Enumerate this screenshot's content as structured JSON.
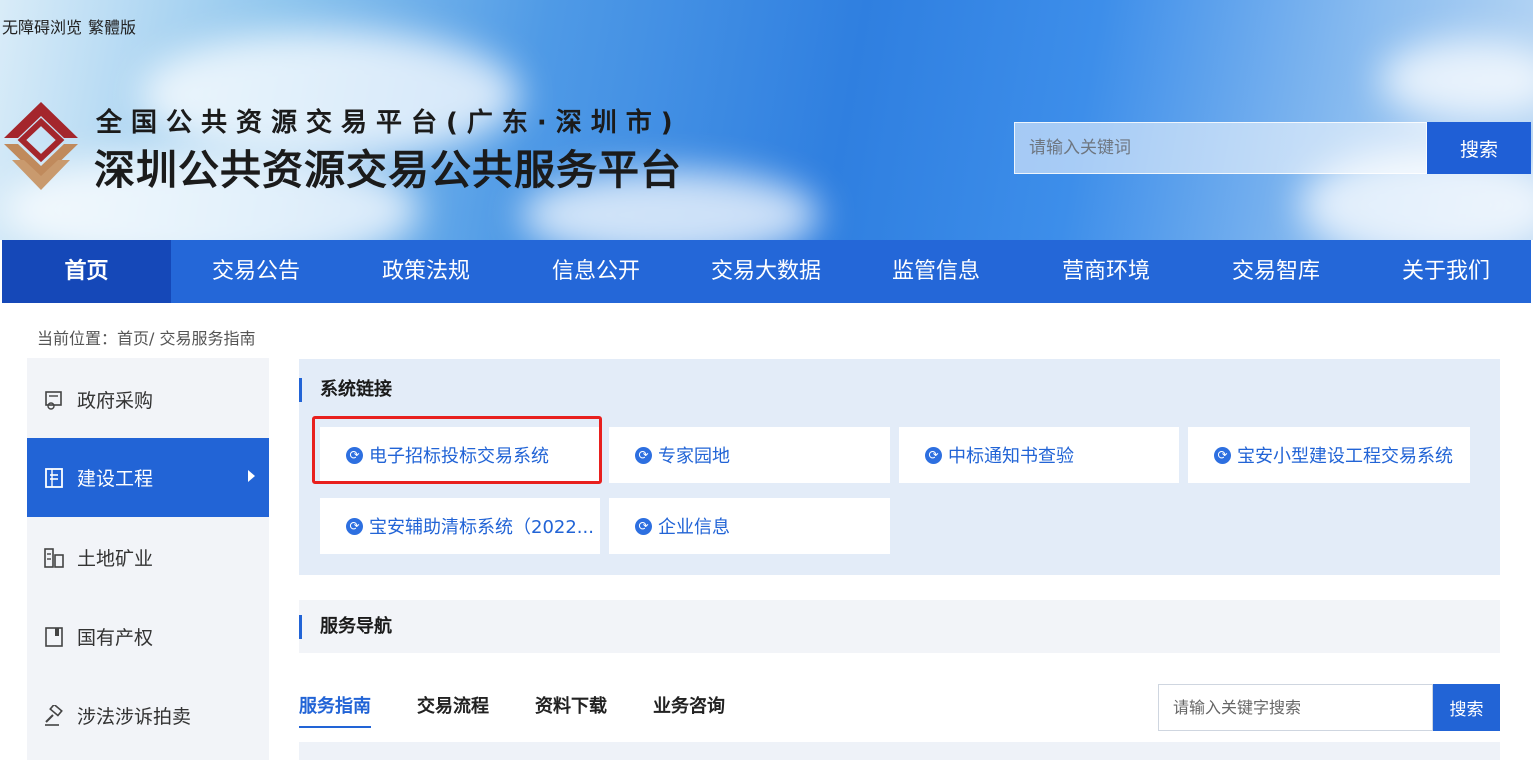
{
  "topbar": {
    "accessibility": "无障碍浏览",
    "traditional": "繁體版"
  },
  "brand": {
    "line1": "全国公共资源交易平台(广东·深圳市)",
    "line2": "深圳公共资源交易公共服务平台"
  },
  "header_search": {
    "placeholder": "请输入关键词",
    "button": "搜索"
  },
  "nav": {
    "items": [
      {
        "label": "首页"
      },
      {
        "label": "交易公告"
      },
      {
        "label": "政策法规"
      },
      {
        "label": "信息公开"
      },
      {
        "label": "交易大数据"
      },
      {
        "label": "监管信息"
      },
      {
        "label": "营商环境"
      },
      {
        "label": "交易智库"
      },
      {
        "label": "关于我们"
      }
    ],
    "active": "首页"
  },
  "breadcrumb": {
    "text": "当前位置：首页/ 交易服务指南"
  },
  "sidebar": {
    "items": [
      {
        "label": "政府采购",
        "icon": "certificate-icon"
      },
      {
        "label": "建设工程",
        "icon": "document-list-icon"
      },
      {
        "label": "土地矿业",
        "icon": "building-icon"
      },
      {
        "label": "国有产权",
        "icon": "book-icon"
      },
      {
        "label": "涉法涉诉拍卖",
        "icon": "gavel-icon"
      }
    ],
    "active": "建设工程"
  },
  "system_links": {
    "title": "系统链接",
    "items": [
      {
        "label": "电子招标投标交易系统"
      },
      {
        "label": "专家园地"
      },
      {
        "label": "中标通知书查验"
      },
      {
        "label": "宝安小型建设工程交易系统"
      },
      {
        "label": "宝安辅助清标系统（2022..."
      },
      {
        "label": "企业信息"
      }
    ]
  },
  "service_nav": {
    "title": "服务导航",
    "tabs": [
      {
        "label": "服务指南"
      },
      {
        "label": "交易流程"
      },
      {
        "label": "资料下载"
      },
      {
        "label": "业务咨询"
      }
    ],
    "active_tab": "服务指南",
    "search": {
      "placeholder": "请输入关键字搜索",
      "button": "搜索"
    }
  },
  "colors": {
    "primary": "#2264d6",
    "nav_active": "#1548b8",
    "highlight": "#e8201e",
    "panel_bg": "#e3ecf8"
  }
}
